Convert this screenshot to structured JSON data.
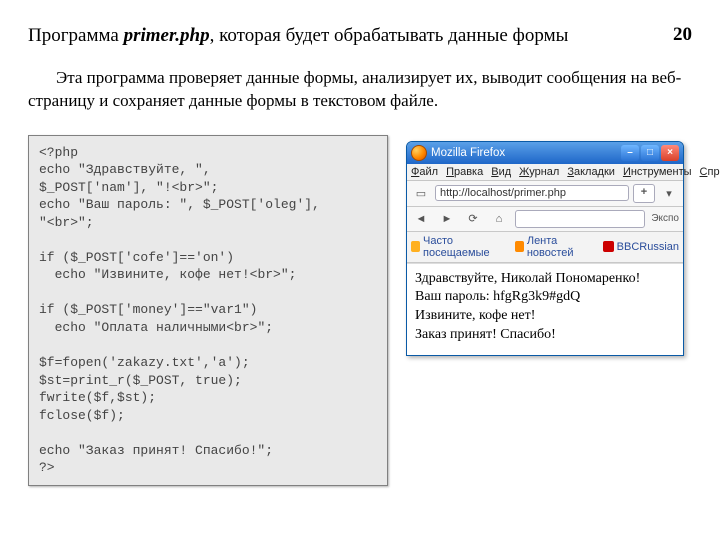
{
  "header": {
    "title_prefix": "Программа ",
    "filename": "primer.php",
    "title_suffix": ", которая будет обрабатывать  данные  формы",
    "page_number": "20"
  },
  "intro": "Эта  программа  проверяет  данные  формы,  анализирует их, выводит сообщения на веб-страницу и сохраняет данные формы в текстовом файле.",
  "code": "<?php\necho \"Здравствуйте, \",\n$_POST['nam'], \"!<br>\";\necho \"Ваш пароль: \", $_POST['oleg'],\n\"<br>\";\n\nif ($_POST['cofe']=='on')\n  echo \"Извините, кофе нет!<br>\";\n\nif ($_POST['money']==\"var1\")\n  echo \"Оплата наличными<br>\";\n\n$f=fopen('zakazy.txt','a');\n$st=print_r($_POST, true);\nfwrite($f,$st);\nfclose($f);\n\necho \"Заказ принят! Спасибо!\";\n?>",
  "browser": {
    "window_title": "Mozilla Firefox",
    "menu": {
      "file": "Файл",
      "edit": "Правка",
      "view": "Вид",
      "journal": "Журнал",
      "bookmarks": "Закладки",
      "tools": "Инструменты",
      "help": "Справка"
    },
    "address": "http://localhost/primer.php",
    "newtab": "+",
    "search_engine": "Экспо",
    "bookmarks_bar": {
      "most_visited": "Часто посещаемые",
      "news_feed": "Лента новостей",
      "bbc": "BBCRussian"
    },
    "page": {
      "line1": "Здравствуйте, Николай Пономаренко!",
      "line2": "Ваш пароль: hfgRg3k9#gdQ",
      "line3": "Извините, кофе нет!",
      "line4": "Заказ принят! Спасибо!"
    }
  }
}
